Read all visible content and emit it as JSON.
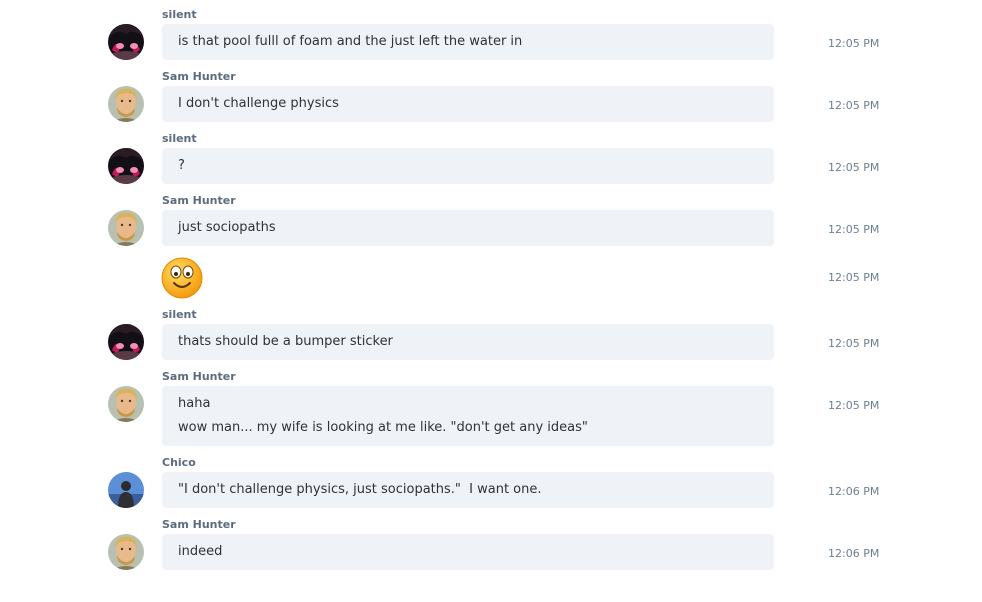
{
  "messages": [
    {
      "sender": "silent",
      "avatar": "dark-anime-avatar",
      "lines": [
        "is that pool fulll of foam and the just left the water in"
      ],
      "time": "12:05 PM"
    },
    {
      "sender": "Sam Hunter",
      "avatar": "blond-man-avatar",
      "lines": [
        "I don't challenge physics"
      ],
      "time": "12:05 PM"
    },
    {
      "sender": "silent",
      "avatar": "dark-anime-avatar",
      "lines": [
        "?"
      ],
      "time": "12:05 PM"
    },
    {
      "sender": "Sam Hunter",
      "avatar": "blond-man-avatar",
      "lines": [
        "just sociopaths"
      ],
      "time": "12:05 PM"
    },
    {
      "sender": "",
      "avatar": "",
      "emoji": "smile-emoticon",
      "lines": [],
      "time": "12:05 PM"
    },
    {
      "sender": "silent",
      "avatar": "dark-anime-avatar",
      "lines": [
        "thats should be a bumper sticker"
      ],
      "time": "12:05 PM"
    },
    {
      "sender": "Sam Hunter",
      "avatar": "blond-man-avatar",
      "lines": [
        "haha",
        "wow man... my wife is looking at me like. \"don't get any ideas\""
      ],
      "time": "12:05 PM"
    },
    {
      "sender": "Chico",
      "avatar": "blue-sky-avatar",
      "lines": [
        "\"I don't challenge physics, just sociopaths.\"  I want one."
      ],
      "time": "12:06 PM"
    },
    {
      "sender": "Sam Hunter",
      "avatar": "blond-man-avatar",
      "lines": [
        "indeed"
      ],
      "time": "12:06 PM"
    }
  ]
}
